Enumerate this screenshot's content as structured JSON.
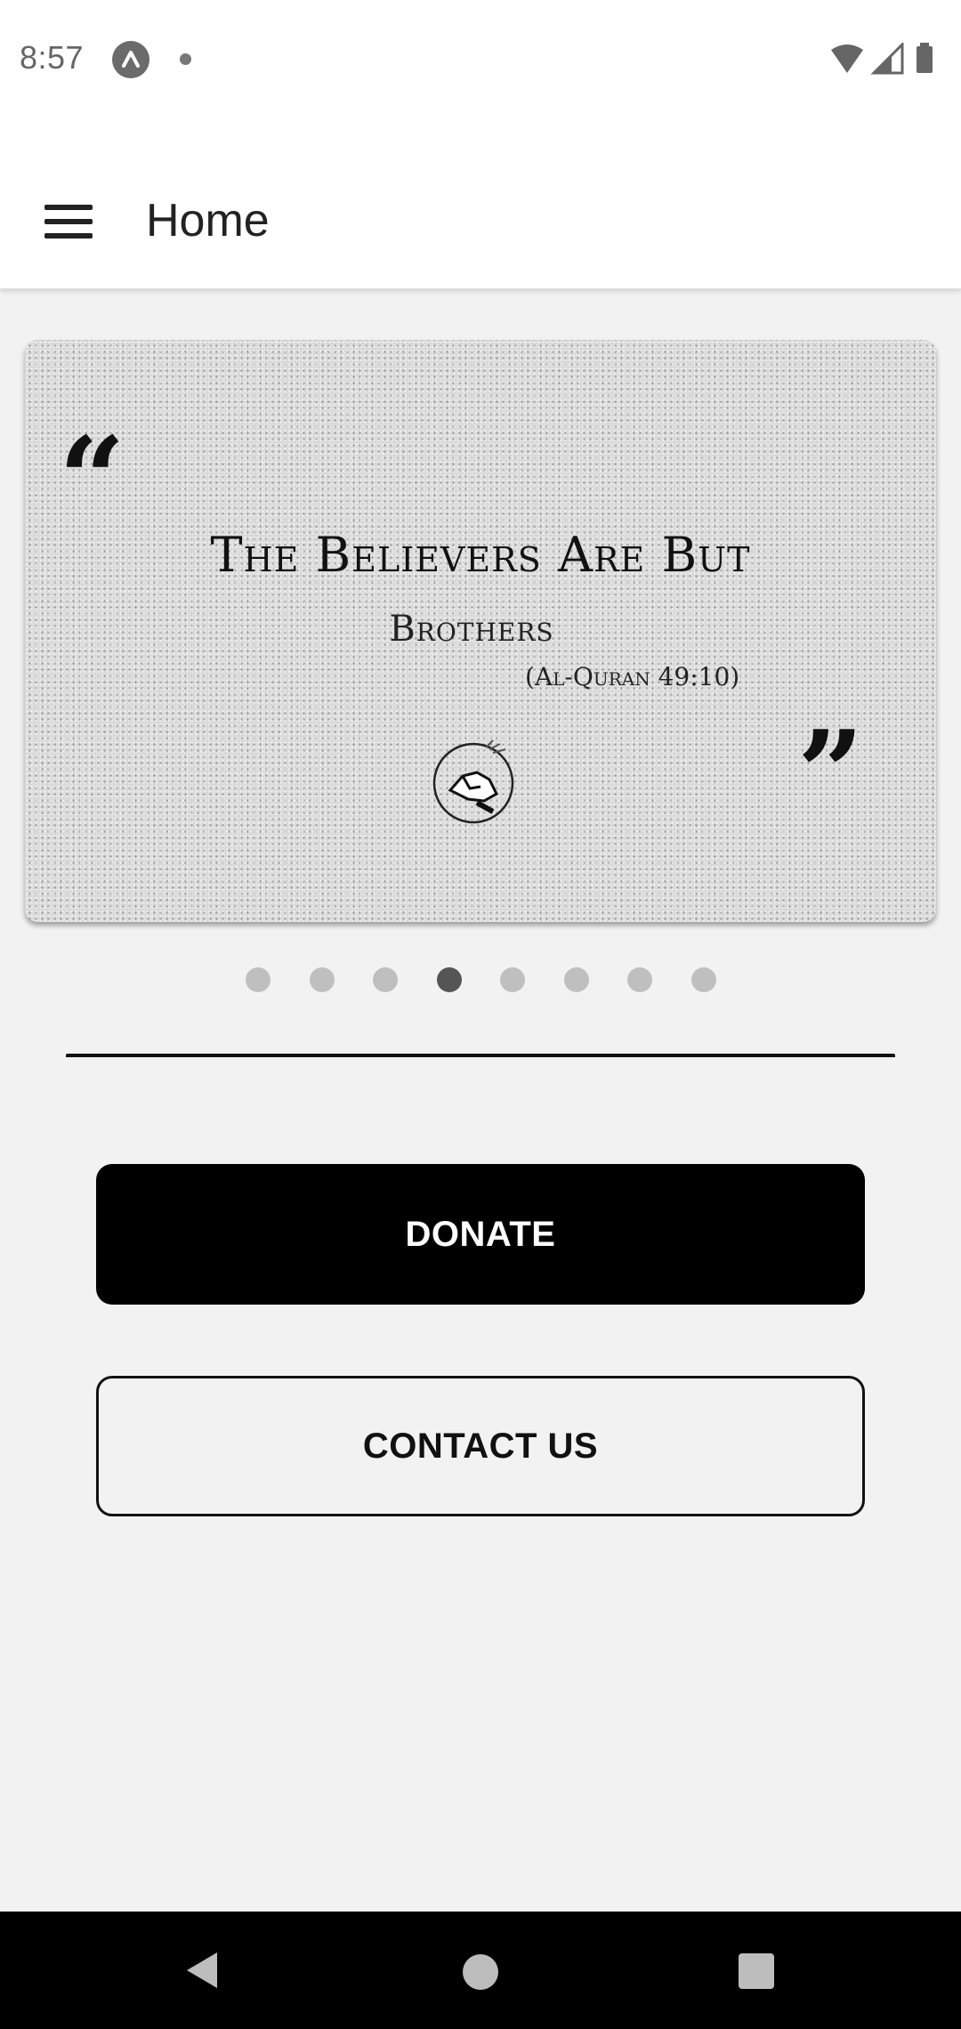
{
  "status_bar": {
    "time": "8:57",
    "icons": [
      "app-notification-icon",
      "dot-icon",
      "wifi-icon",
      "signal-icon",
      "battery-icon"
    ]
  },
  "app_bar": {
    "title": "Home",
    "menu_icon": "hamburger-menu-icon"
  },
  "carousel": {
    "quote_open": "“",
    "quote_close": "”",
    "quote_line1": "The Believers Are But",
    "quote_line2": "Brothers",
    "quote_source": "(Al-Quran 49:10)",
    "logo_icon": "handshake-icon",
    "page_count": 8,
    "active_index": 3
  },
  "buttons": {
    "donate_label": "DONATE",
    "contact_label": "CONTACT US"
  },
  "nav_bar": {
    "icons": [
      "back-icon",
      "home-icon",
      "recents-icon"
    ]
  },
  "colors": {
    "primary_button": "#000000",
    "background": "#f2f2f2",
    "indicator_active": "#555555",
    "indicator_inactive": "#bfbfbf"
  }
}
